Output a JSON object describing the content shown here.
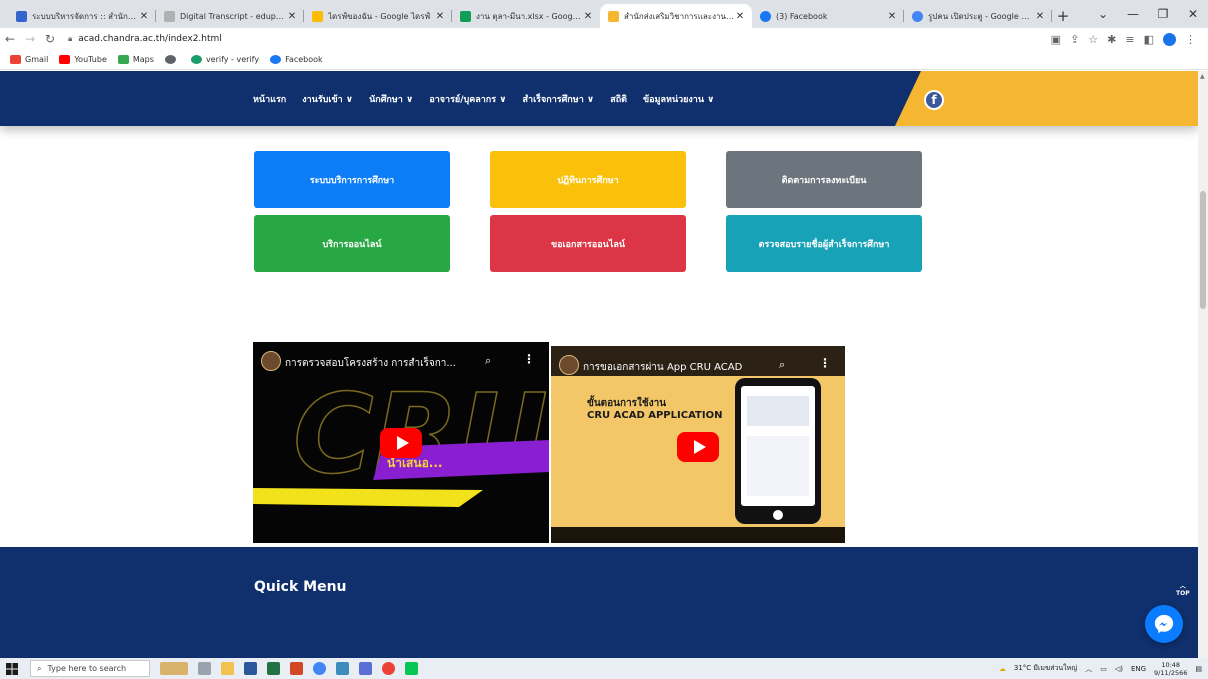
{
  "browser": {
    "tabs": [
      {
        "title": "ระบบบริหารจัดการ :: สำนักส่งเสริมวิชาการ",
        "color": "#3366cc",
        "active": false
      },
      {
        "title": "Digital Transcript - eduprompt",
        "color": "#b0b0b0",
        "active": false
      },
      {
        "title": "ไดรฟ์ของฉัน - Google ไดรฟ์",
        "color": "#fbbc04",
        "active": false
      },
      {
        "title": "งาน ตุลา-มีนา.xlsx - Google ชีต",
        "color": "#0f9d58",
        "active": false
      },
      {
        "title": "สำนักส่งเสริมวิชาการและงานทะเบียน",
        "color": "#f5b731",
        "active": true
      },
      {
        "title": "(3) Facebook",
        "color": "#1877f2",
        "active": false
      },
      {
        "title": "รูปคน เปิดประตู - Google Search",
        "color": "#4285f4",
        "active": false
      }
    ],
    "new_tab": "+",
    "url": "acad.chandra.ac.th/index2.html",
    "bookmarks": [
      {
        "label": "Gmail",
        "color": "#ea4335"
      },
      {
        "label": "YouTube",
        "color": "#ff0000"
      },
      {
        "label": "Maps",
        "color": "#34a853"
      },
      {
        "label": "",
        "color": "#5f6368"
      },
      {
        "label": "verify - verify",
        "color": "#1a9e6e"
      },
      {
        "label": "Facebook",
        "color": "#1877f2"
      }
    ]
  },
  "site": {
    "nav": [
      "หน้าแรก",
      "งานรับเข้า ∨",
      "นักศึกษา ∨",
      "อาจารย์/บุคลากร ∨",
      "สำเร็จการศึกษา ∨",
      "สถิติ",
      "ข้อมูลหน่วยงาน ∨"
    ],
    "facebook_glyph": "f",
    "quick_buttons": [
      {
        "label": "ระบบบริการการศึกษา",
        "color": "#0d7df7"
      },
      {
        "label": "ปฏิทินการศึกษา",
        "color": "#fbc10a"
      },
      {
        "label": "ติดตามการลงทะเบียน",
        "color": "#6c757d"
      },
      {
        "label": "บริการออนไลน์",
        "color": "#28a745"
      },
      {
        "label": "ขอเอกสารออนไลน์",
        "color": "#dc3545"
      },
      {
        "label": "ตรวจสอบรายชื่อผู้สำเร็จการศึกษา",
        "color": "#17a2b8"
      }
    ],
    "videos": [
      {
        "title": "การตรวจสอบโครงสร้าง การสำเร็จกา...",
        "banner": "นำเสนอ..."
      },
      {
        "title": "การขอเอกสารผ่าน App CRU ACAD",
        "heading_line1": "ขั้นตอนการใช้งาน",
        "heading_line2": "CRU ACAD APPLICATION"
      }
    ],
    "quick_menu_title": "Quick Menu",
    "top_label": "TOP"
  },
  "taskbar": {
    "search_placeholder": "Type here to search",
    "weather": "31°C มีเมฆส่วนใหญ่",
    "lang": "ENG",
    "time": "10:48",
    "date": "9/11/2566"
  }
}
